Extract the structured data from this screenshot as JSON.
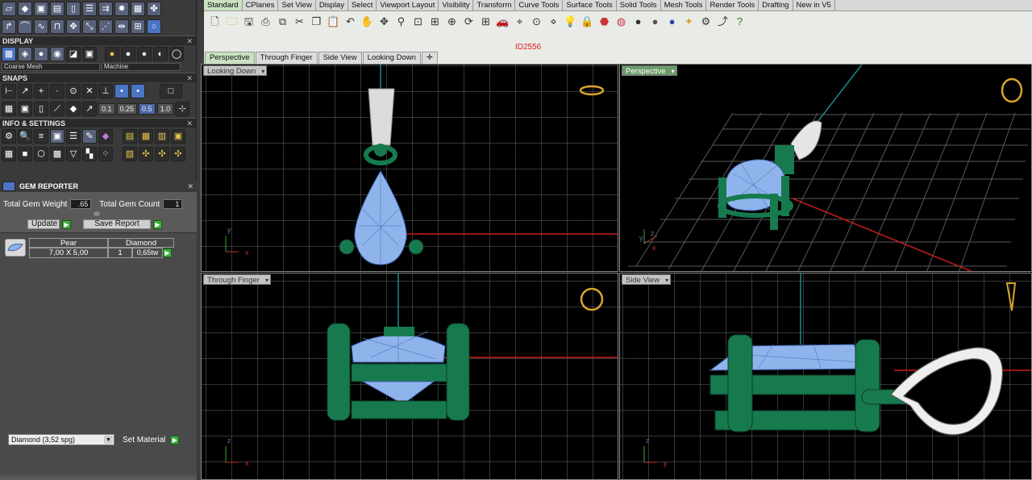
{
  "display": {
    "title": "DISPLAY",
    "mode1": "Coarse Mesh",
    "mode2": "Machine"
  },
  "snaps": {
    "title": "SNAPS",
    "values": [
      "0.1",
      "0.25",
      "0.5",
      "1.0"
    ],
    "active_index": 2
  },
  "info": {
    "title": "INFO & SETTINGS"
  },
  "gem_reporter": {
    "title": "GEM REPORTER",
    "weight_label": "Total Gem Weight",
    "weight_value": ".65",
    "count_label": "Total Gem Count",
    "count_value": "1",
    "update_label": "Update",
    "save_label": "Save Report",
    "row": {
      "shape": "Pear",
      "material": "Diamond",
      "size": "7,00 X 5,00",
      "count": "1",
      "weight": "0,65tw"
    },
    "material_select": "Diamond     (3,52 spg)",
    "set_material_label": "Set Material"
  },
  "tabs": [
    "Standard",
    "CPlanes",
    "Set View",
    "Display",
    "Select",
    "Viewport Layout",
    "Visibility",
    "Transform",
    "Curve Tools",
    "Surface Tools",
    "Solid Tools",
    "Mesh Tools",
    "Render Tools",
    "Drafting",
    "New in V5"
  ],
  "id_text": "ID2556",
  "view_tabs": [
    "Perspective",
    "Through Finger",
    "Side View",
    "Looking Down"
  ],
  "viewports": {
    "looking_down": "Looking Down",
    "perspective": "Perspective",
    "through_finger": "Through Finger",
    "side_view": "Side View"
  },
  "axes": {
    "x": "x",
    "y": "y",
    "z": "z"
  },
  "colors": {
    "gem": "#8fb4ec",
    "metal": "#1a8a5a",
    "bail": "#e8e8e8",
    "accent_tab": "#c9e2c0"
  }
}
